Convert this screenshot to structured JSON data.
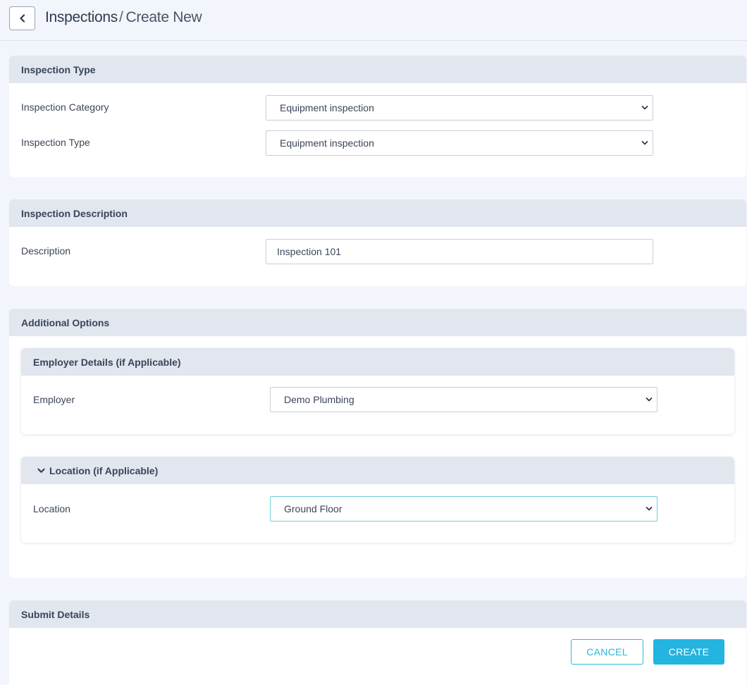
{
  "header": {
    "title_main": "Inspections",
    "title_separator": "/",
    "title_sub": "Create New"
  },
  "inspection_type": {
    "heading": "Inspection Type",
    "category_label": "Inspection Category",
    "category_value": "Equipment inspection",
    "type_label": "Inspection Type",
    "type_value": "Equipment inspection"
  },
  "inspection_description": {
    "heading": "Inspection Description",
    "description_label": "Description",
    "description_value": "Inspection 101"
  },
  "additional_options": {
    "heading": "Additional Options",
    "employer_section": {
      "heading": "Employer Details (if Applicable)",
      "employer_label": "Employer",
      "employer_value": "Demo Plumbing"
    },
    "location_section": {
      "heading": "Location (if Applicable)",
      "location_label": "Location",
      "location_value": "Ground Floor"
    }
  },
  "submit": {
    "heading": "Submit Details",
    "cancel_label": "CANCEL",
    "create_label": "CREATE"
  },
  "colors": {
    "accent": "#23b4e0",
    "panel_header_bg": "#e1e6ef",
    "page_bg": "#f2f5fb"
  },
  "icons": {
    "back": "chevron-left-icon",
    "select": "chevron-down-icon",
    "collapse": "chevron-down-icon"
  }
}
